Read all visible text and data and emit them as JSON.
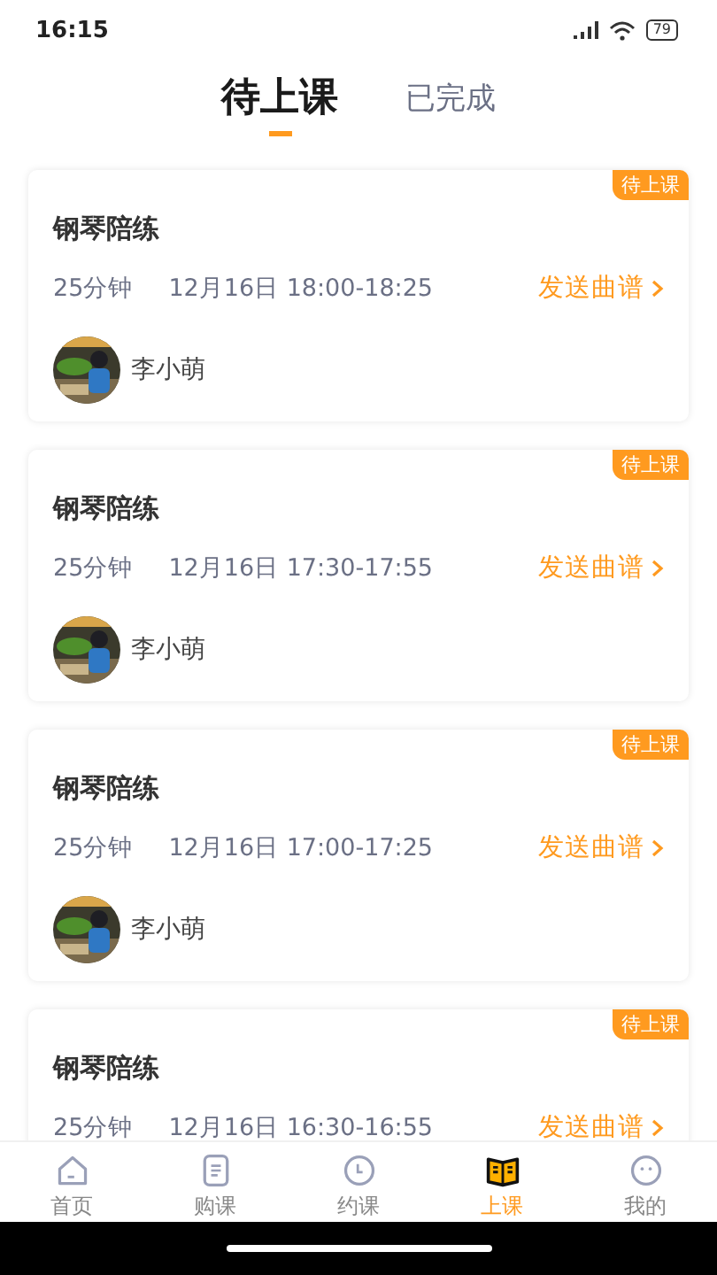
{
  "status_bar": {
    "time": "16:15",
    "battery": "79"
  },
  "tabs": [
    {
      "label": "待上课",
      "selected": true
    },
    {
      "label": "已完成",
      "selected": false
    }
  ],
  "lessons": [
    {
      "title": "钢琴陪练",
      "badge": "待上课",
      "duration": "25分钟",
      "time": "12月16日 18:00-18:25",
      "action": "发送曲谱",
      "student": "李小萌"
    },
    {
      "title": "钢琴陪练",
      "badge": "待上课",
      "duration": "25分钟",
      "time": "12月16日 17:30-17:55",
      "action": "发送曲谱",
      "student": "李小萌"
    },
    {
      "title": "钢琴陪练",
      "badge": "待上课",
      "duration": "25分钟",
      "time": "12月16日 17:00-17:25",
      "action": "发送曲谱",
      "student": "李小萌"
    },
    {
      "title": "钢琴陪练",
      "badge": "待上课",
      "duration": "25分钟",
      "time": "12月16日 16:30-16:55",
      "action": "发送曲谱"
    }
  ],
  "nav": [
    {
      "label": "首页",
      "kind": "home",
      "selected": false
    },
    {
      "label": "购课",
      "kind": "list",
      "selected": false
    },
    {
      "label": "约课",
      "kind": "clock",
      "selected": false
    },
    {
      "label": "上课",
      "kind": "book",
      "selected": true
    },
    {
      "label": "我的",
      "kind": "face",
      "selected": false
    }
  ]
}
